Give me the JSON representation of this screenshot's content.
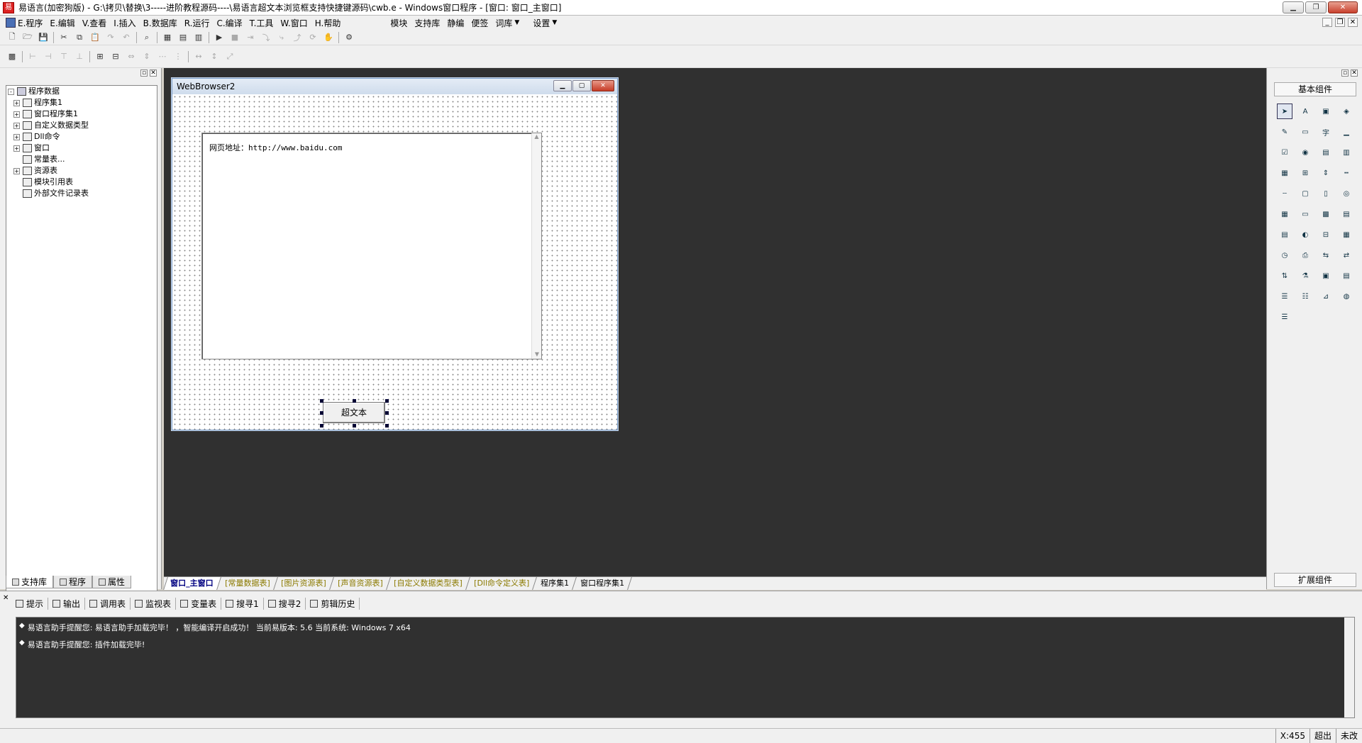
{
  "window": {
    "title": "易语言(加密狗版) - G:\\拷贝\\替换\\3-----进阶教程源码----\\易语言超文本浏览框支持快捷键源码\\cwb.e - Windows窗口程序 - [窗口: 窗口_主窗口]",
    "app_icon_text": "易"
  },
  "menu": {
    "items": [
      "E.程序",
      "E.编辑",
      "V.查看",
      "I.插入",
      "B.数据库",
      "R.运行",
      "C.编译",
      "T.工具",
      "W.窗口",
      "H.帮助"
    ],
    "extra": [
      "模块",
      "支持库",
      "静编",
      "便签",
      "词库",
      "设置"
    ]
  },
  "left_panel": {
    "tree": [
      {
        "label": "程序数据",
        "level": 0,
        "expander": "-"
      },
      {
        "label": "程序集1",
        "level": 1,
        "expander": "+"
      },
      {
        "label": "窗口程序集1",
        "level": 1,
        "expander": "+"
      },
      {
        "label": "自定义数据类型",
        "level": 1,
        "expander": "+"
      },
      {
        "label": "Dll命令",
        "level": 1,
        "expander": "+"
      },
      {
        "label": "窗口",
        "level": 1,
        "expander": "+"
      },
      {
        "label": "常量表...",
        "level": 1,
        "expander": ""
      },
      {
        "label": "资源表",
        "level": 1,
        "expander": "+"
      },
      {
        "label": "模块引用表",
        "level": 1,
        "expander": ""
      },
      {
        "label": "外部文件记录表",
        "level": 1,
        "expander": ""
      }
    ],
    "tabs": [
      "支持库",
      "程序",
      "属性"
    ]
  },
  "design_window": {
    "title": "WebBrowser2",
    "richtext_content": "网页地址：http://www.baidu.com",
    "button_label": "超文本"
  },
  "doc_tabs": [
    {
      "label": "窗口_主窗口",
      "style": "active"
    },
    {
      "label": "[常量数据表]",
      "style": "yl"
    },
    {
      "label": "[图片资源表]",
      "style": "yl"
    },
    {
      "label": "[声音资源表]",
      "style": "yl"
    },
    {
      "label": "[自定义数据类型表]",
      "style": "yl"
    },
    {
      "label": "[Dll命令定义表]",
      "style": "yl"
    },
    {
      "label": "程序集1",
      "style": ""
    },
    {
      "label": "窗口程序集1",
      "style": ""
    }
  ],
  "right_panel": {
    "header": "基本组件",
    "footer": "扩展组件"
  },
  "output": {
    "tabs": [
      "提示",
      "输出",
      "调用表",
      "监视表",
      "变量表",
      "搜寻1",
      "搜寻2",
      "剪辑历史"
    ],
    "lines": [
      "易语言助手提醒您: 易语言助手加载完毕！ ，智能编译开启成功！ 当前易版本: 5.6  当前系统: Windows 7 x64",
      "易语言助手提醒您: 插件加载完毕!"
    ]
  },
  "status": {
    "coord": "X:455",
    "mode": "超出",
    "state": "未改"
  }
}
